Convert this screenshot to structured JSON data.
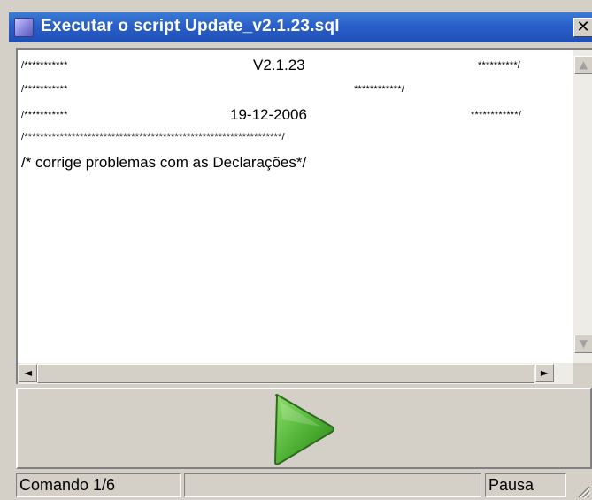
{
  "window": {
    "title": "Executar o script Update_v2.1.23.sql",
    "close_label": "✕",
    "app_icon": "document-icon"
  },
  "script": {
    "lines": [
      {
        "left": "/***********",
        "center": "V2.1.23",
        "right": "**********/"
      },
      {
        "left": "/***********",
        "center": "",
        "right": "************/"
      },
      {
        "left": "/***********",
        "center": "19-12-2006",
        "right": "************/"
      },
      {
        "left": "/*****************************************************************/",
        "center": "",
        "right": ""
      },
      {
        "left": "/* corrige problemas com as Declarações*/",
        "center": "",
        "right": ""
      }
    ]
  },
  "scrollbars": {
    "up_arrow": "▲",
    "down_arrow": "▼",
    "left_arrow": "◄",
    "right_arrow": "►"
  },
  "play_button": {
    "icon": "play-icon",
    "color": "#4caf33"
  },
  "statusbar": {
    "command_label": "Comando 1/6",
    "middle_text": "",
    "state_label": "Pausa"
  }
}
